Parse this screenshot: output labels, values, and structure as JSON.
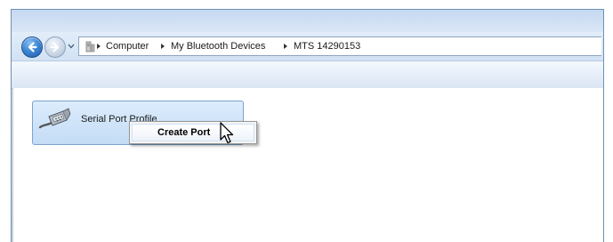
{
  "breadcrumb": {
    "items": [
      "Computer",
      "My Bluetooth Devices",
      "MTS 14290153"
    ]
  },
  "icons": {
    "back": "back-arrow-icon",
    "forward": "forward-arrow-icon",
    "recent": "recent-pages-icon",
    "address": "computer-folder-icon",
    "item": "serial-port-icon",
    "cursor": "mouse-pointer-icon"
  },
  "content": {
    "items": [
      {
        "label": "Serial Port Profile"
      }
    ]
  },
  "context_menu": {
    "items": [
      {
        "label": "Create Port"
      }
    ]
  },
  "colors": {
    "frame_border": "#6f8fb2",
    "selection": "#c4dcf6",
    "accent": "#3e88d6"
  }
}
